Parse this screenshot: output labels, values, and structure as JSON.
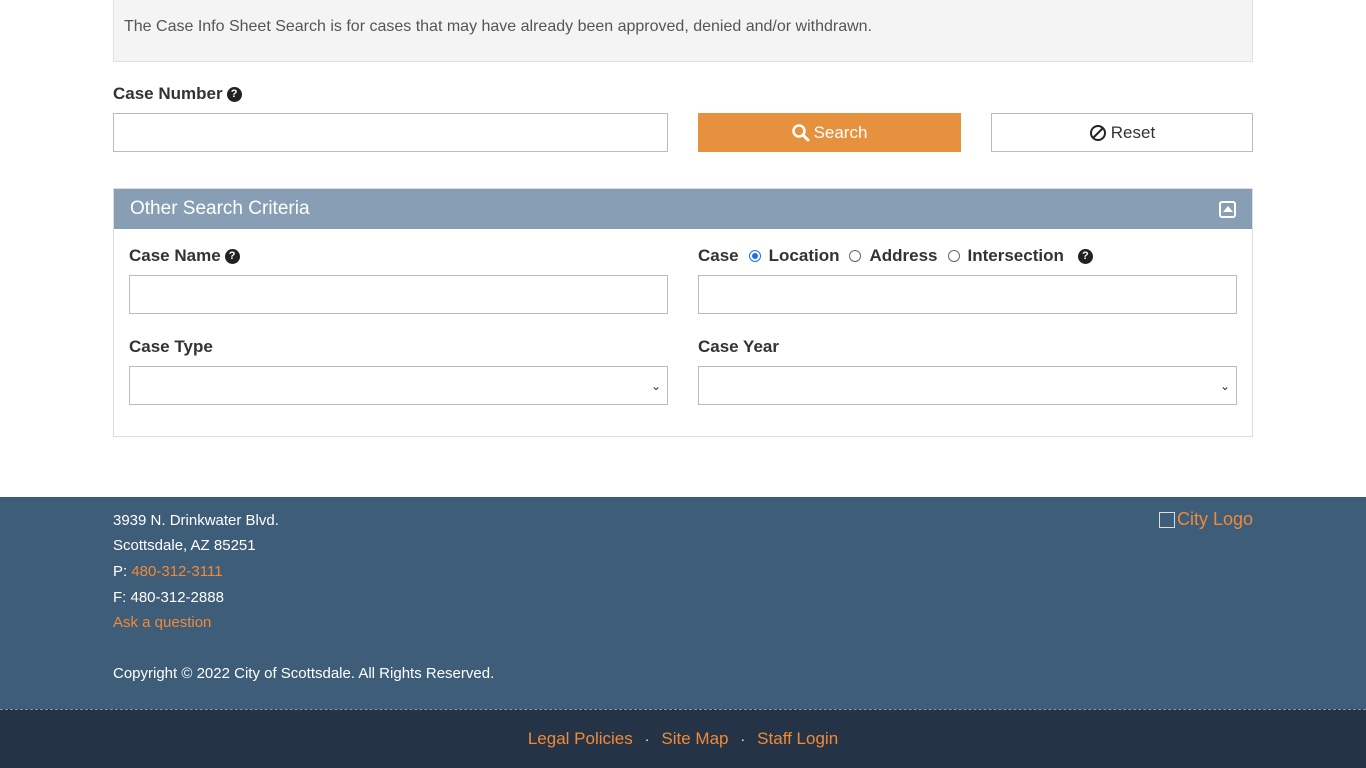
{
  "info": {
    "text": "The Case Info Sheet Search is for cases that may have already been approved, denied and/or withdrawn."
  },
  "case_number": {
    "label": "Case Number",
    "value": ""
  },
  "buttons": {
    "search": "Search",
    "reset": "Reset"
  },
  "panel": {
    "title": "Other Search Criteria",
    "case_name_label": "Case Name",
    "case_name_value": "",
    "location_prefix": "Case",
    "radio_location": "Location",
    "radio_address": "Address",
    "radio_intersection": "Intersection",
    "location_value": "",
    "case_type_label": "Case Type",
    "case_type_selected": "",
    "case_year_label": "Case Year",
    "case_year_selected": ""
  },
  "footer": {
    "address1": "3939 N. Drinkwater Blvd.",
    "address2": "Scottsdale, AZ 85251",
    "phone_prefix": "P: ",
    "phone": "480-312-3111",
    "fax": "F: 480-312-2888",
    "ask": "Ask a question",
    "copyright": "Copyright © 2022 City of Scottsdale. All Rights Reserved.",
    "logo_alt": "City Logo"
  },
  "bottom_links": {
    "legal": "Legal Policies",
    "sitemap": "Site Map",
    "staff": "Staff Login",
    "separator": "·"
  },
  "colors": {
    "accent": "#e6913d",
    "panel_header": "#879eb5",
    "footer": "#3e5d78",
    "bottom_bar": "#243446",
    "link": "#f08a3a"
  }
}
